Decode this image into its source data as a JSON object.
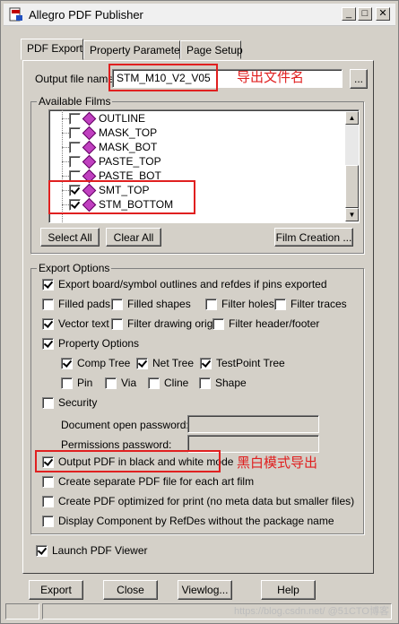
{
  "window": {
    "title": "Allegro PDF Publisher"
  },
  "titlebar_buttons": {
    "minimize": "_",
    "maximize": "□",
    "close": "✕"
  },
  "tabs": [
    {
      "label": "PDF Export",
      "active": true
    },
    {
      "label": "Property Parameters",
      "active": false
    },
    {
      "label": "Page Setup",
      "active": false
    }
  ],
  "output": {
    "label": "Output file name:",
    "value": "STM_M10_V2_V05",
    "browse_label": "...",
    "annotation": "导出文件名"
  },
  "films": {
    "legend": "Available Films",
    "items": [
      {
        "name": "OUTLINE",
        "checked": false
      },
      {
        "name": "MASK_TOP",
        "checked": false
      },
      {
        "name": "MASK_BOT",
        "checked": false
      },
      {
        "name": "PASTE_TOP",
        "checked": false
      },
      {
        "name": "PASTE_BOT",
        "checked": false
      },
      {
        "name": "SMT_TOP",
        "checked": true
      },
      {
        "name": "STM_BOTTOM",
        "checked": true
      }
    ],
    "select_all": "Select All",
    "clear_all": "Clear All",
    "film_creation": "Film Creation ..."
  },
  "export_options": {
    "legend": "Export Options",
    "board_outlines": {
      "label": "Export board/symbol outlines and refdes if pins exported",
      "checked": true
    },
    "filled_pads": {
      "label": "Filled pads",
      "checked": false
    },
    "filled_shapes": {
      "label": "Filled shapes",
      "checked": false
    },
    "filter_holes": {
      "label": "Filter holes",
      "checked": false
    },
    "filter_traces": {
      "label": "Filter traces",
      "checked": false
    },
    "vector_text": {
      "label": "Vector text",
      "checked": true
    },
    "filter_drawing_origin": {
      "label": "Filter drawing origin",
      "checked": false
    },
    "filter_header_footer": {
      "label": "Filter header/footer",
      "checked": false
    },
    "property_options": {
      "label": "Property Options",
      "checked": true
    },
    "comp_tree": {
      "label": "Comp Tree",
      "checked": true
    },
    "net_tree": {
      "label": "Net Tree",
      "checked": true
    },
    "testpoint_tree": {
      "label": "TestPoint Tree",
      "checked": true
    },
    "pin": {
      "label": "Pin",
      "checked": false
    },
    "via": {
      "label": "Via",
      "checked": false
    },
    "cline": {
      "label": "Cline",
      "checked": false
    },
    "shape": {
      "label": "Shape",
      "checked": false
    },
    "security": {
      "label": "Security",
      "checked": false
    },
    "doc_open_password": {
      "label": "Document open password:",
      "value": ""
    },
    "permissions_password": {
      "label": "Permissions password:",
      "value": ""
    },
    "black_white": {
      "label": "Output PDF in black and white mode",
      "checked": true,
      "annotation": "黑白模式导出"
    },
    "separate_pdf": {
      "label": "Create separate PDF file for each art film",
      "checked": false
    },
    "optimized_print": {
      "label": "Create PDF optimized for print (no meta data but smaller files)",
      "checked": false
    },
    "display_component": {
      "label": "Display Component by RefDes without the package name",
      "checked": false
    }
  },
  "launch_viewer": {
    "label": "Launch PDF Viewer",
    "checked": true
  },
  "buttons": {
    "export": "Export",
    "close": "Close",
    "viewlog": "Viewlog...",
    "help": "Help"
  },
  "watermark": "https://blog.csdn.net/ @51CTO博客"
}
